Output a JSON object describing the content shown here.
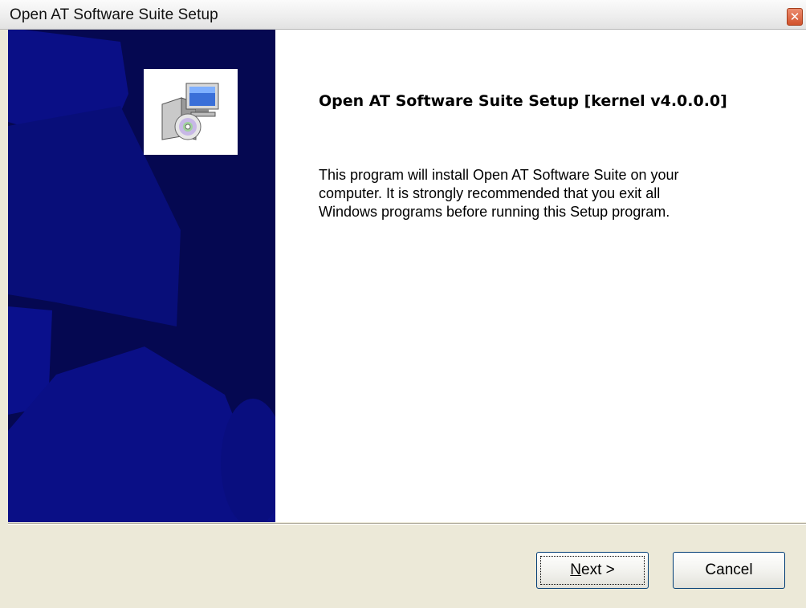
{
  "window": {
    "title": "Open AT Software Suite Setup",
    "close_glyph": "✕",
    "colors": {
      "banner": "#050851",
      "banner_shape": "#0a0f86",
      "content_bg": "#ffffff",
      "chrome": "#ece9d8",
      "close_button": "#d9603a"
    }
  },
  "banner": {
    "icon": "installer-computer-cd-icon"
  },
  "content": {
    "heading": "Open AT Software Suite Setup [kernel v4.0.0.0]",
    "body_lines": [
      "This program will install Open AT Software Suite on your",
      "computer.  It is strongly recommended that you exit all",
      "Windows programs before running this Setup program."
    ]
  },
  "buttons": {
    "next_mnemonic": "N",
    "next_rest": "ext >",
    "cancel": "Cancel"
  }
}
